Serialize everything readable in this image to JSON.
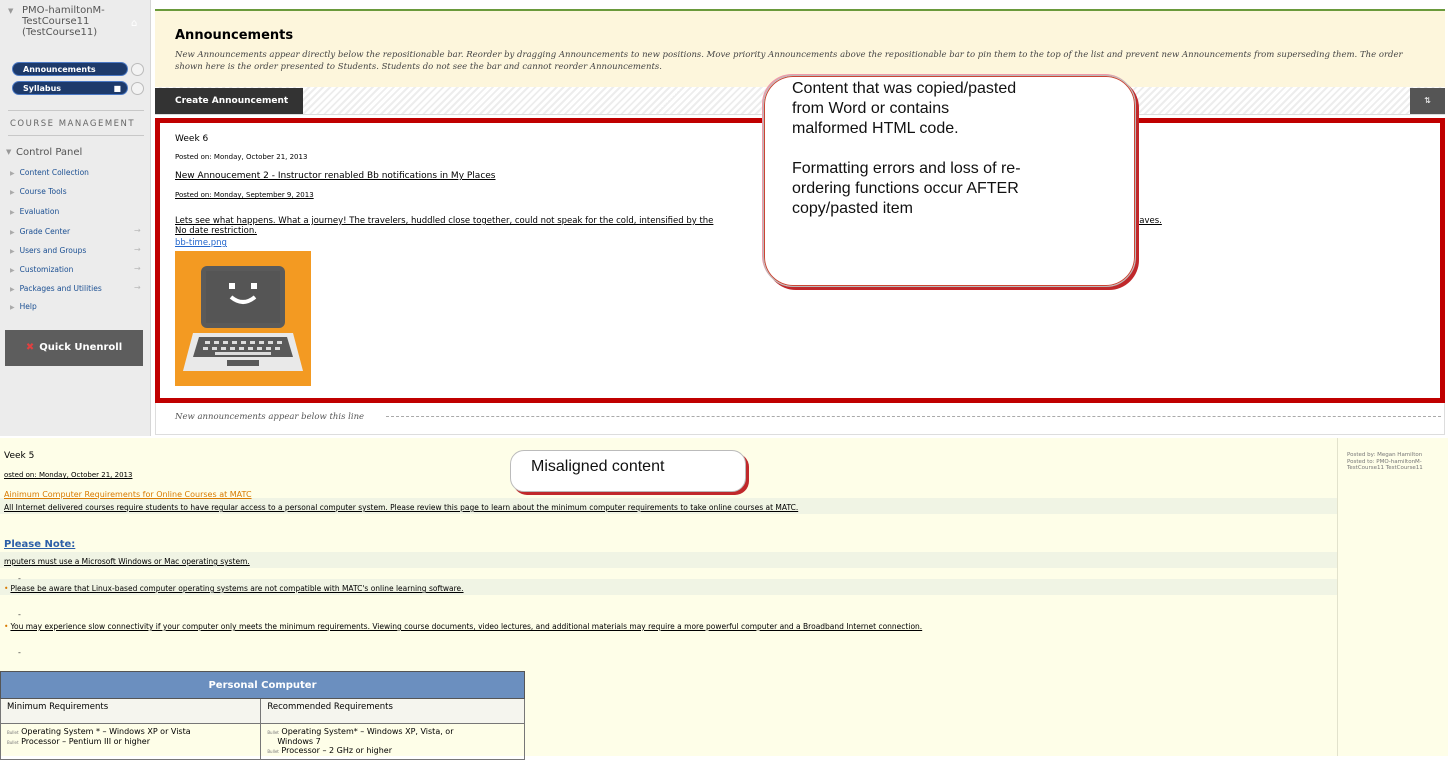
{
  "sidebar": {
    "course_title_lines": [
      "PMO-hamiltonM-",
      "TestCourse11",
      "(TestCourse11)"
    ],
    "menu": [
      {
        "label": "Announcements"
      },
      {
        "label": "Syllabus"
      }
    ],
    "course_management_label": "COURSE MANAGEMENT",
    "control_panel_label": "Control Panel",
    "control_panel_items": [
      {
        "label": "Content Collection"
      },
      {
        "label": "Course Tools"
      },
      {
        "label": "Evaluation"
      },
      {
        "label": "Grade Center"
      },
      {
        "label": "Users and Groups"
      },
      {
        "label": "Customization"
      },
      {
        "label": "Packages and Utilities"
      },
      {
        "label": "Help"
      }
    ],
    "quick_unenroll_label": "Quick Unenroll"
  },
  "header": {
    "title": "Announcements",
    "description": "New Announcements appear directly below the repositionable bar. Reorder by dragging Announcements to new positions. Move priority Announcements above the repositionable bar to pin them to the top of the list and prevent new Announcements from superseding them. The order shown here is the order presented to Students. Students do not see the bar and cannot reorder Announcements."
  },
  "toolbar": {
    "create_label": "Create Announcement",
    "sort_label": "⇅"
  },
  "week6": {
    "title": "Week 6",
    "posted1": "Posted on: Monday, October 21, 2013",
    "link": "New Annoucement 2 - Instructor renabled Bb notifications in My Places",
    "posted2": "Posted on: Monday, September 9, 2013",
    "body_start": "Lets see what happens. What a journey! The travelers, huddled close together, could not speak for the cold, intensified by the",
    "body_end": "he waves.",
    "no_date": "No date restriction.",
    "file": "bb-time.png"
  },
  "callouts": {
    "big_lines": [
      "Content that was copied/pasted",
      "from Word or contains",
      "malformed HTML code.",
      "",
      "Formatting errors and loss of re-",
      "ordering functions occur AFTER",
      "copy/pasted item"
    ],
    "small": "Misaligned content"
  },
  "divider_text": "New announcements appear below this line",
  "week5": {
    "title": "Veek 5",
    "posted": "osted on: Monday, October 21, 2013",
    "meta_lines": [
      "Posted by: Megan Hamilton",
      "Posted to: PMO-hamiltonM-",
      "TestCourse11 TestCourse11"
    ],
    "link": "Ainimum Computer Requirements for Online Courses at MATC",
    "line1": "All Internet delivered courses require students to have regular access to a personal computer system. Please review this page to learn about the minimum computer requirements to take online courses at MATC.",
    "note": "Please Note:",
    "line2": "mputers must use a Microsoft Windows or Mac operating system.",
    "line3": "Please be aware that Linux-based computer operating systems are not compatible with MATC's online learning software.",
    "line4": "You may experience slow connectivity if your computer only meets the minimum requirements. Viewing course documents, video lectures, and additional materials may require a more powerful computer and a Broadband Internet connection.",
    "dash": "-"
  },
  "table": {
    "title": "Personal Computer",
    "col_min": "Minimum Requirements",
    "col_rec": "Recommended Requirements",
    "min_items": [
      "Operating System * – Windows XP or Vista",
      "Processor – Pentium III or higher"
    ],
    "rec_items": [
      "Operating System* – Windows XP, Vista, or",
      "Windows 7",
      "Processor – 2 GHz or higher"
    ],
    "tag": "Bullet"
  },
  "colors": {
    "callout_border": "#c0282b",
    "frame_red": "#c00000",
    "header_bg": "#fdf6dc",
    "sidebar_button": "#1d3a6b"
  }
}
